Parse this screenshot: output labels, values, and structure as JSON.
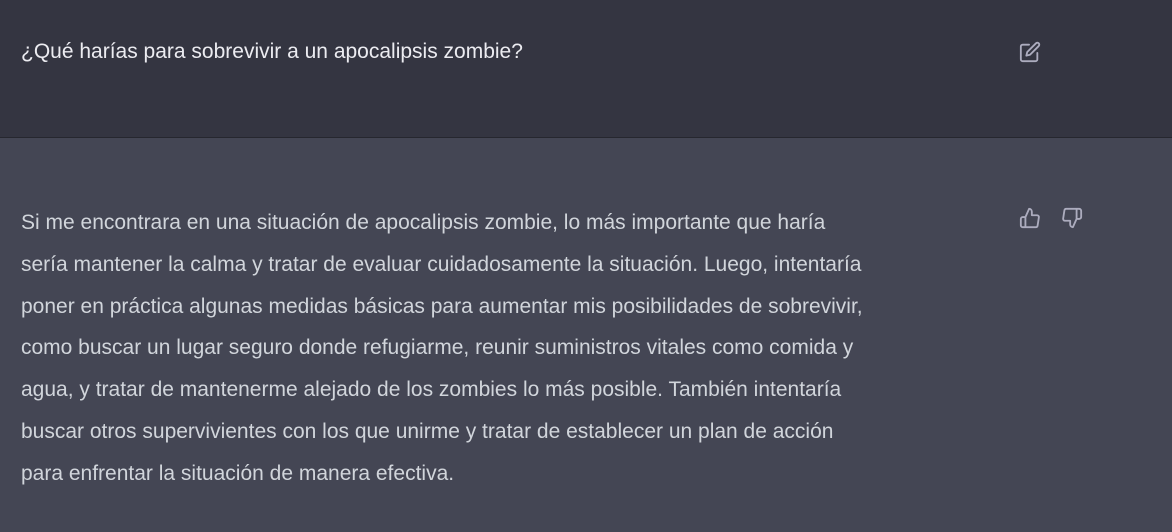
{
  "user_message": {
    "text": "¿Qué harías para sobrevivir a un apocalipsis zombie?",
    "edit_icon": "edit-icon"
  },
  "assistant_message": {
    "lines": [
      "Si me encontrara en una situación de apocalipsis zombie, lo más importante que haría",
      "sería mantener la calma y tratar de evaluar cuidadosamente la situación. Luego, intentaría",
      "poner en práctica algunas medidas básicas para aumentar mis posibilidades de sobrevivir,",
      "como buscar un lugar seguro donde refugiarme, reunir suministros vitales como comida y",
      "agua, y tratar de mantenerme alejado de los zombies lo más posible. También intentaría",
      "buscar otros supervivientes con los que unirme y tratar de establecer un plan de acción",
      "para enfrentar la situación de manera efectiva."
    ],
    "feedback_icons": [
      "thumbs-up-icon",
      "thumbs-down-icon"
    ]
  },
  "colors": {
    "user_bg": "#343541",
    "assistant_bg": "#444654",
    "user_text": "#ececf1",
    "assistant_text": "#d1d5db",
    "icon": "#acacbe"
  }
}
